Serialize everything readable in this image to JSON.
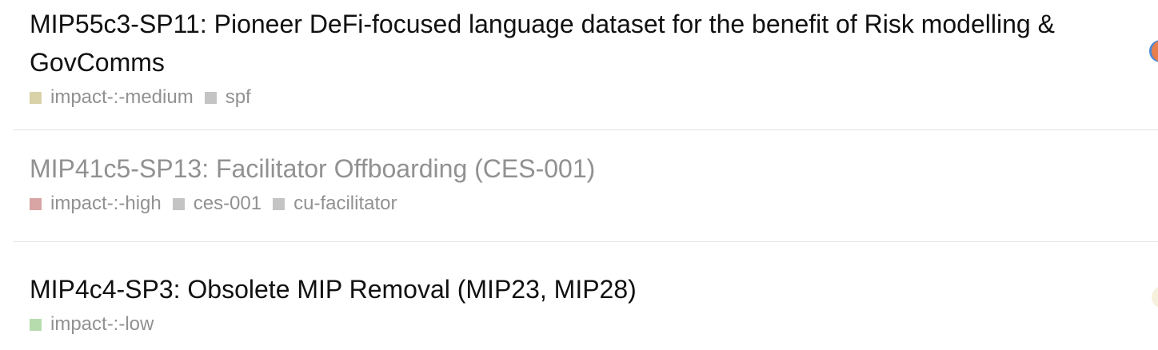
{
  "topics": [
    {
      "title": "MIP55c3-SP11: Pioneer DeFi-focused language dataset for the benefit of Risk modelling & GovComms",
      "visited": false,
      "tags": [
        {
          "label": "impact-:-medium",
          "color": "#d9d1a8"
        },
        {
          "label": "spf",
          "color": "#c4c4c4"
        }
      ]
    },
    {
      "title": "MIP41c5-SP13: Facilitator Offboarding (CES-001)",
      "visited": true,
      "tags": [
        {
          "label": "impact-:-high",
          "color": "#d9a4a4"
        },
        {
          "label": "ces-001",
          "color": "#c4c4c4"
        },
        {
          "label": "cu-facilitator",
          "color": "#c4c4c4"
        }
      ]
    },
    {
      "title": "MIP4c4-SP3: Obsolete MIP Removal (MIP23, MIP28)",
      "visited": false,
      "tags": [
        {
          "label": "impact-:-low",
          "color": "#b6dcae"
        }
      ]
    }
  ]
}
